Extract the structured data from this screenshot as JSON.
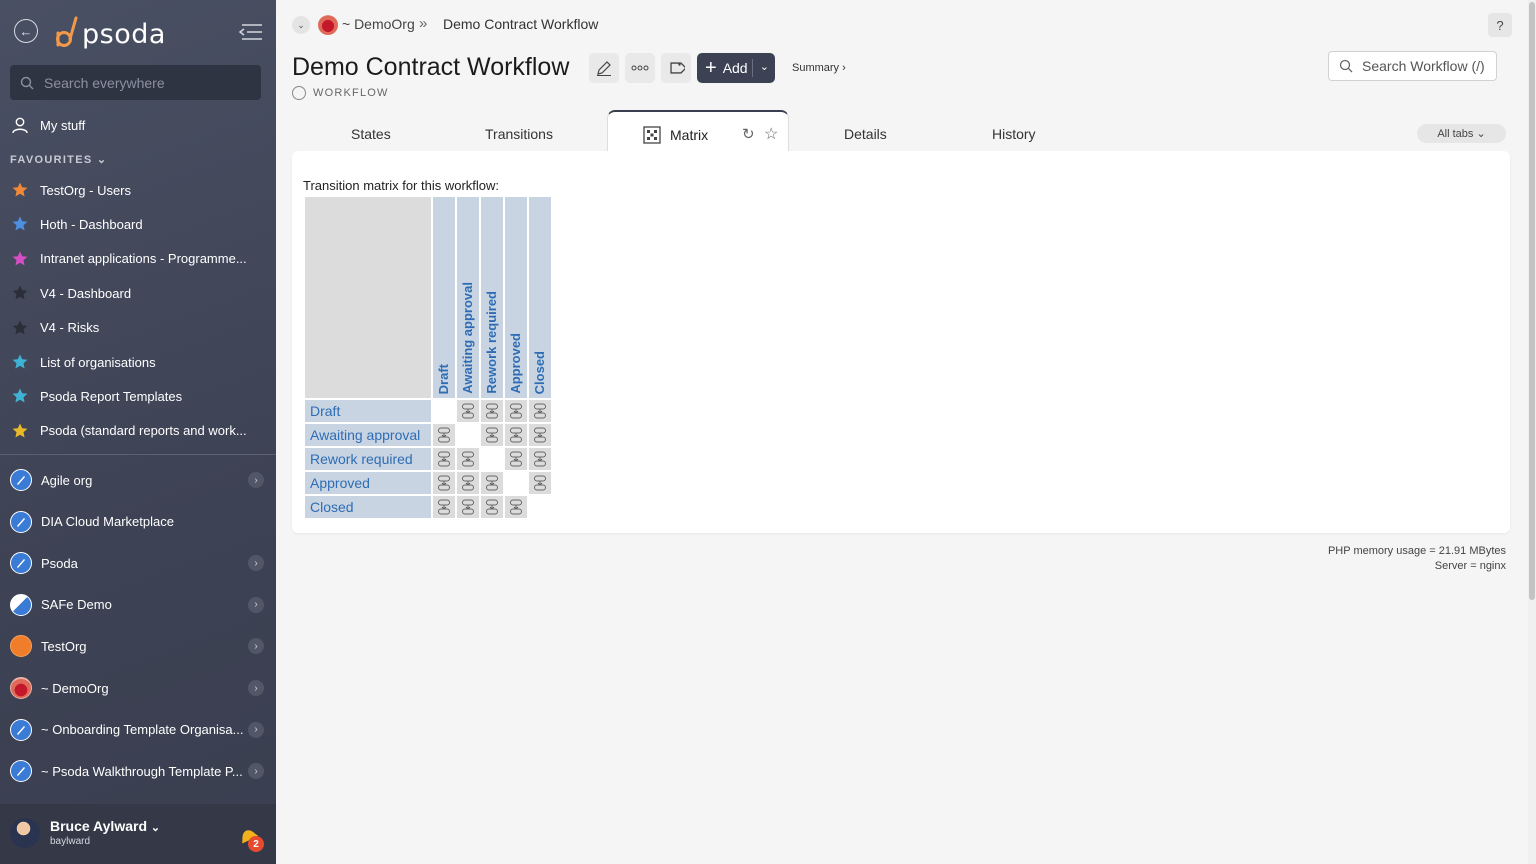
{
  "sidebar": {
    "logo": "psoda",
    "search_placeholder": "Search everywhere",
    "my_stuff": "My stuff",
    "favourites_heading": "FAVOURITES",
    "favourites": [
      {
        "label": "TestOrg - Users",
        "star_color": "#f0883a"
      },
      {
        "label": "Hoth - Dashboard",
        "star_color": "#4d8fe0"
      },
      {
        "label": "Intranet applications - Programme...",
        "star_color": "#d54fc4"
      },
      {
        "label": "V4 - Dashboard",
        "star_color": "#2b2e38"
      },
      {
        "label": "V4 - Risks",
        "star_color": "#2b2e38"
      },
      {
        "label": "List of organisations",
        "star_color": "#3fb3d6"
      },
      {
        "label": "Psoda Report Templates",
        "star_color": "#3fb3d6"
      },
      {
        "label": "Psoda (standard reports and work...",
        "star_color": "#e8b928"
      }
    ],
    "orgs": [
      {
        "label": "Agile org",
        "icon": "compass-icon"
      },
      {
        "label": "DIA Cloud Marketplace",
        "icon": "compass-icon"
      },
      {
        "label": "Psoda",
        "icon": "compass-icon"
      },
      {
        "label": "SAFe Demo",
        "icon": "safe-logo-icon"
      },
      {
        "label": "TestOrg",
        "icon": "orange-circle-icon"
      },
      {
        "label": "~ DemoOrg",
        "icon": "sunset-icon"
      },
      {
        "label": "~ Onboarding Template Organisa...",
        "icon": "compass-icon"
      },
      {
        "label": "~ Psoda Walkthrough Template P...",
        "icon": "compass-icon"
      }
    ],
    "user": {
      "name": "Bruce Aylward",
      "username": "baylward",
      "notifications": "2"
    }
  },
  "breadcrumb": {
    "org": "~ DemoOrg",
    "separator": "»",
    "current": "Demo Contract Workflow"
  },
  "header": {
    "title": "Demo Contract Workflow",
    "type_label": "WORKFLOW",
    "add_label": "Add",
    "summary_link": "Summary ›",
    "search_placeholder": "Search Workflow (/)",
    "help": "?"
  },
  "tabs": {
    "items": [
      "States",
      "Transitions",
      "Matrix",
      "Details",
      "History"
    ],
    "active": "Matrix",
    "all_tabs": "All tabs"
  },
  "matrix": {
    "caption": "Transition matrix for this workflow:",
    "states": [
      "Draft",
      "Awaiting approval",
      "Rework required",
      "Approved",
      "Closed"
    ],
    "transitions": [
      [
        false,
        true,
        true,
        true,
        true
      ],
      [
        true,
        false,
        true,
        true,
        true
      ],
      [
        true,
        true,
        false,
        true,
        true
      ],
      [
        true,
        true,
        true,
        false,
        true
      ],
      [
        true,
        true,
        true,
        true,
        false
      ]
    ]
  },
  "footer": {
    "memory": "PHP memory usage = 21.91 MBytes",
    "server": "Server = nginx"
  },
  "colors": {
    "sidebar_bg": "#3d4254",
    "accent": "#3c4254",
    "link": "#2e6db4",
    "header_cell": "#c9d4e3"
  }
}
